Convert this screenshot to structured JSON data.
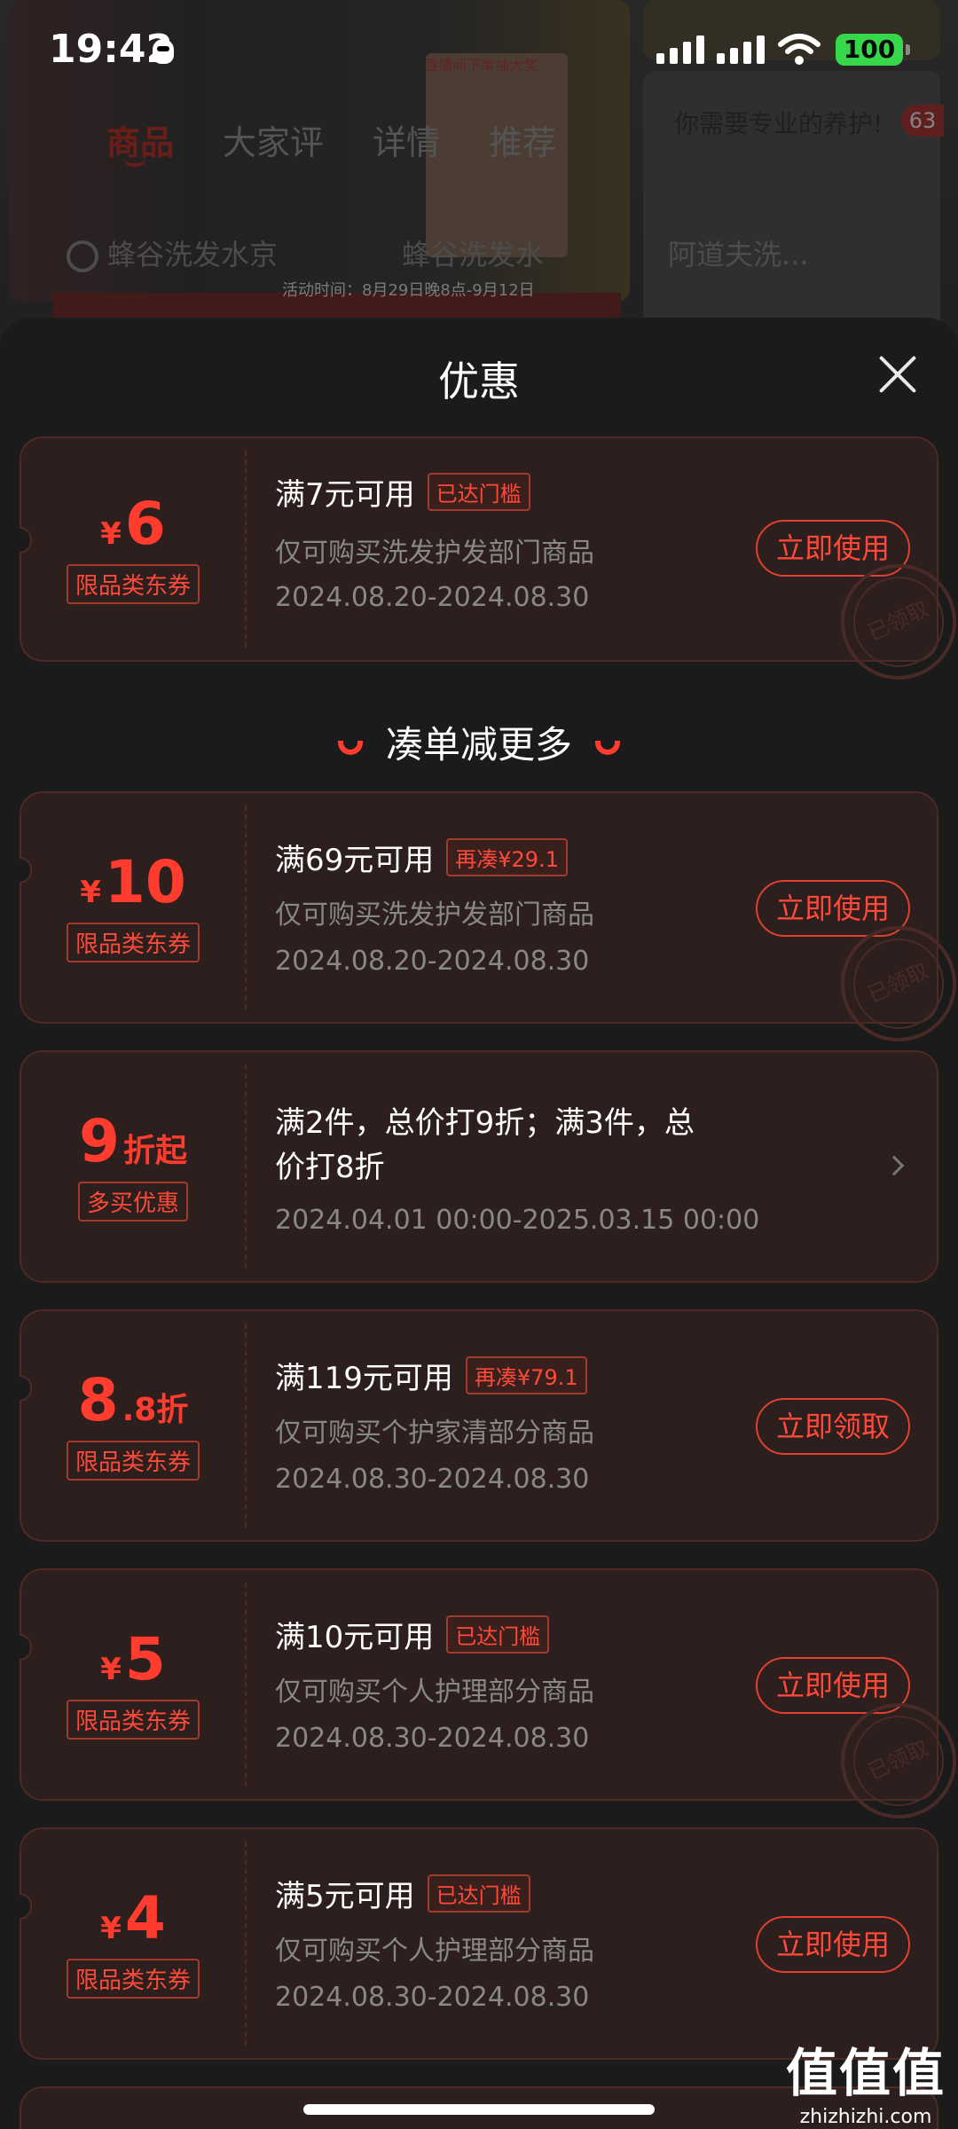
{
  "status_bar": {
    "time": "19:42",
    "battery": "100"
  },
  "background_page": {
    "tabs": [
      "商品",
      "大家评",
      "详情",
      "推荐"
    ],
    "search": [
      "蜂谷洗发水京",
      "蜂谷洗发水",
      "阿道夫洗..."
    ],
    "badge": "63",
    "ad_text": "你需要专业的养护!",
    "promo_text": "直播间下单抽大奖",
    "event_text": "活动时间：8月29日晚8点-9月12日"
  },
  "sheet": {
    "title": "优惠",
    "section_heading": "凑单减更多"
  },
  "coupons": [
    {
      "currency": "¥",
      "amount": "6",
      "suffix": "",
      "tag": "限品类东券",
      "condition": "满7元可用",
      "pill": "已达门槛",
      "scope": "仅可购买洗发护发部门商品",
      "validity": "2024.08.20-2024.08.30",
      "button": "立即使用",
      "stamp": "已领取"
    },
    {
      "currency": "¥",
      "amount": "10",
      "suffix": "",
      "tag": "限品类东券",
      "condition": "满69元可用",
      "pill": "再凑¥29.1",
      "scope": "仅可购买洗发护发部门商品",
      "validity": "2024.08.20-2024.08.30",
      "button": "立即使用",
      "stamp": "已领取"
    },
    {
      "currency": "",
      "amount": "9",
      "suffix": "折起",
      "tag": "多买优惠",
      "condition": "满2件，总价打9折；满3件，总",
      "condition2": "价打8折",
      "validity": "2024.04.01 00:00-2025.03.15 00:00"
    },
    {
      "currency": "",
      "amount": "8",
      "suffix": ".8折",
      "tag": "限品类东券",
      "condition": "满119元可用",
      "pill": "再凑¥79.1",
      "scope": "仅可购买个护家清部分商品",
      "validity": "2024.08.30-2024.08.30",
      "button": "立即领取"
    },
    {
      "currency": "¥",
      "amount": "5",
      "suffix": "",
      "tag": "限品类东券",
      "condition": "满10元可用",
      "pill": "已达门槛",
      "scope": "仅可购买个人护理部分商品",
      "validity": "2024.08.30-2024.08.30",
      "button": "立即使用",
      "stamp": "已领取"
    },
    {
      "currency": "¥",
      "amount": "4",
      "suffix": "",
      "tag": "限品类东券",
      "condition": "满5元可用",
      "pill": "已达门槛",
      "scope": "仅可购买个人护理部分商品",
      "validity": "2024.08.30-2024.08.30",
      "button": "立即使用"
    }
  ],
  "watermark": {
    "big": "值值值",
    "small": "zhizhizhi.com"
  },
  "colors": {
    "accent": "#ff3c2e",
    "sheet_bg": "#1b1b1b",
    "card_bg": "#2c1f1d",
    "card_border": "#4e2a25"
  }
}
